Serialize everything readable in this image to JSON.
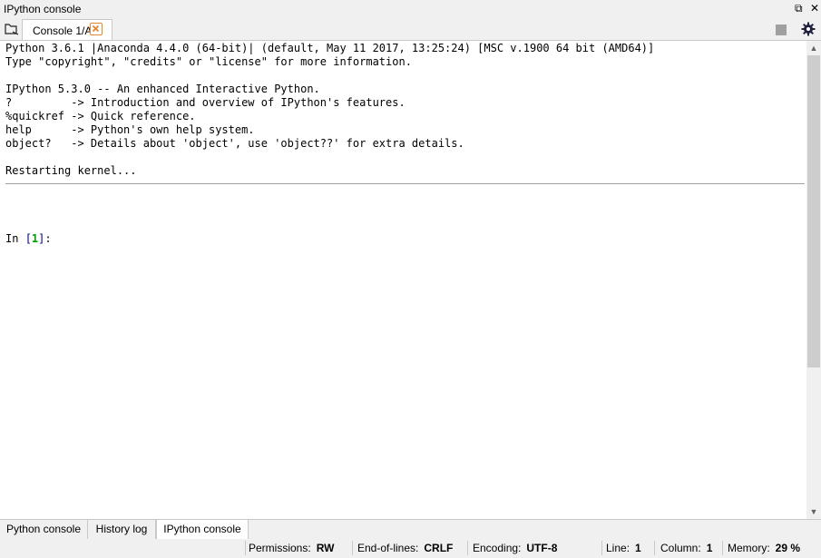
{
  "pane": {
    "title": "IPython console",
    "undock_glyph": "⧉",
    "close_glyph": "✕"
  },
  "tabs": [
    {
      "label": "Console 1/A",
      "active": true
    }
  ],
  "toolbar": {
    "browse_icon": "browse-tabs-icon",
    "stop_icon": "stop-icon",
    "options_icon": "gear-icon"
  },
  "console": {
    "banner": "Python 3.6.1 |Anaconda 4.4.0 (64-bit)| (default, May 11 2017, 13:25:24) [MSC v.1900 64 bit (AMD64)]\nType \"copyright\", \"credits\" or \"license\" for more information.\n\nIPython 5.3.0 -- An enhanced Interactive Python.\n?         -> Introduction and overview of IPython's features.\n%quickref -> Quick reference.\nhelp      -> Python's own help system.\nobject?   -> Details about 'object', use 'object??' for extra details.",
    "restart_message": "Restarting kernel...",
    "prompt": {
      "prefix": "In ",
      "open": "[",
      "number": "1",
      "close": "]",
      "suffix": ":"
    }
  },
  "scrollbar": {
    "up_glyph": "▲",
    "down_glyph": "▼"
  },
  "bottom_tabs": [
    {
      "label": "Python console",
      "active": false
    },
    {
      "label": "History log",
      "active": false
    },
    {
      "label": "IPython console",
      "active": true
    }
  ],
  "status": {
    "permissions_label": "Permissions:",
    "permissions_value": "RW",
    "eol_label": "End-of-lines:",
    "eol_value": "CRLF",
    "encoding_label": "Encoding:",
    "encoding_value": "UTF-8",
    "line_label": "Line:",
    "line_value": "1",
    "column_label": "Column:",
    "column_value": "1",
    "memory_label": "Memory:",
    "memory_value": "29 %"
  },
  "colors": {
    "close_accent": "#e8842a",
    "prompt_number": "#00a000",
    "prompt_bracket": "#000080"
  }
}
